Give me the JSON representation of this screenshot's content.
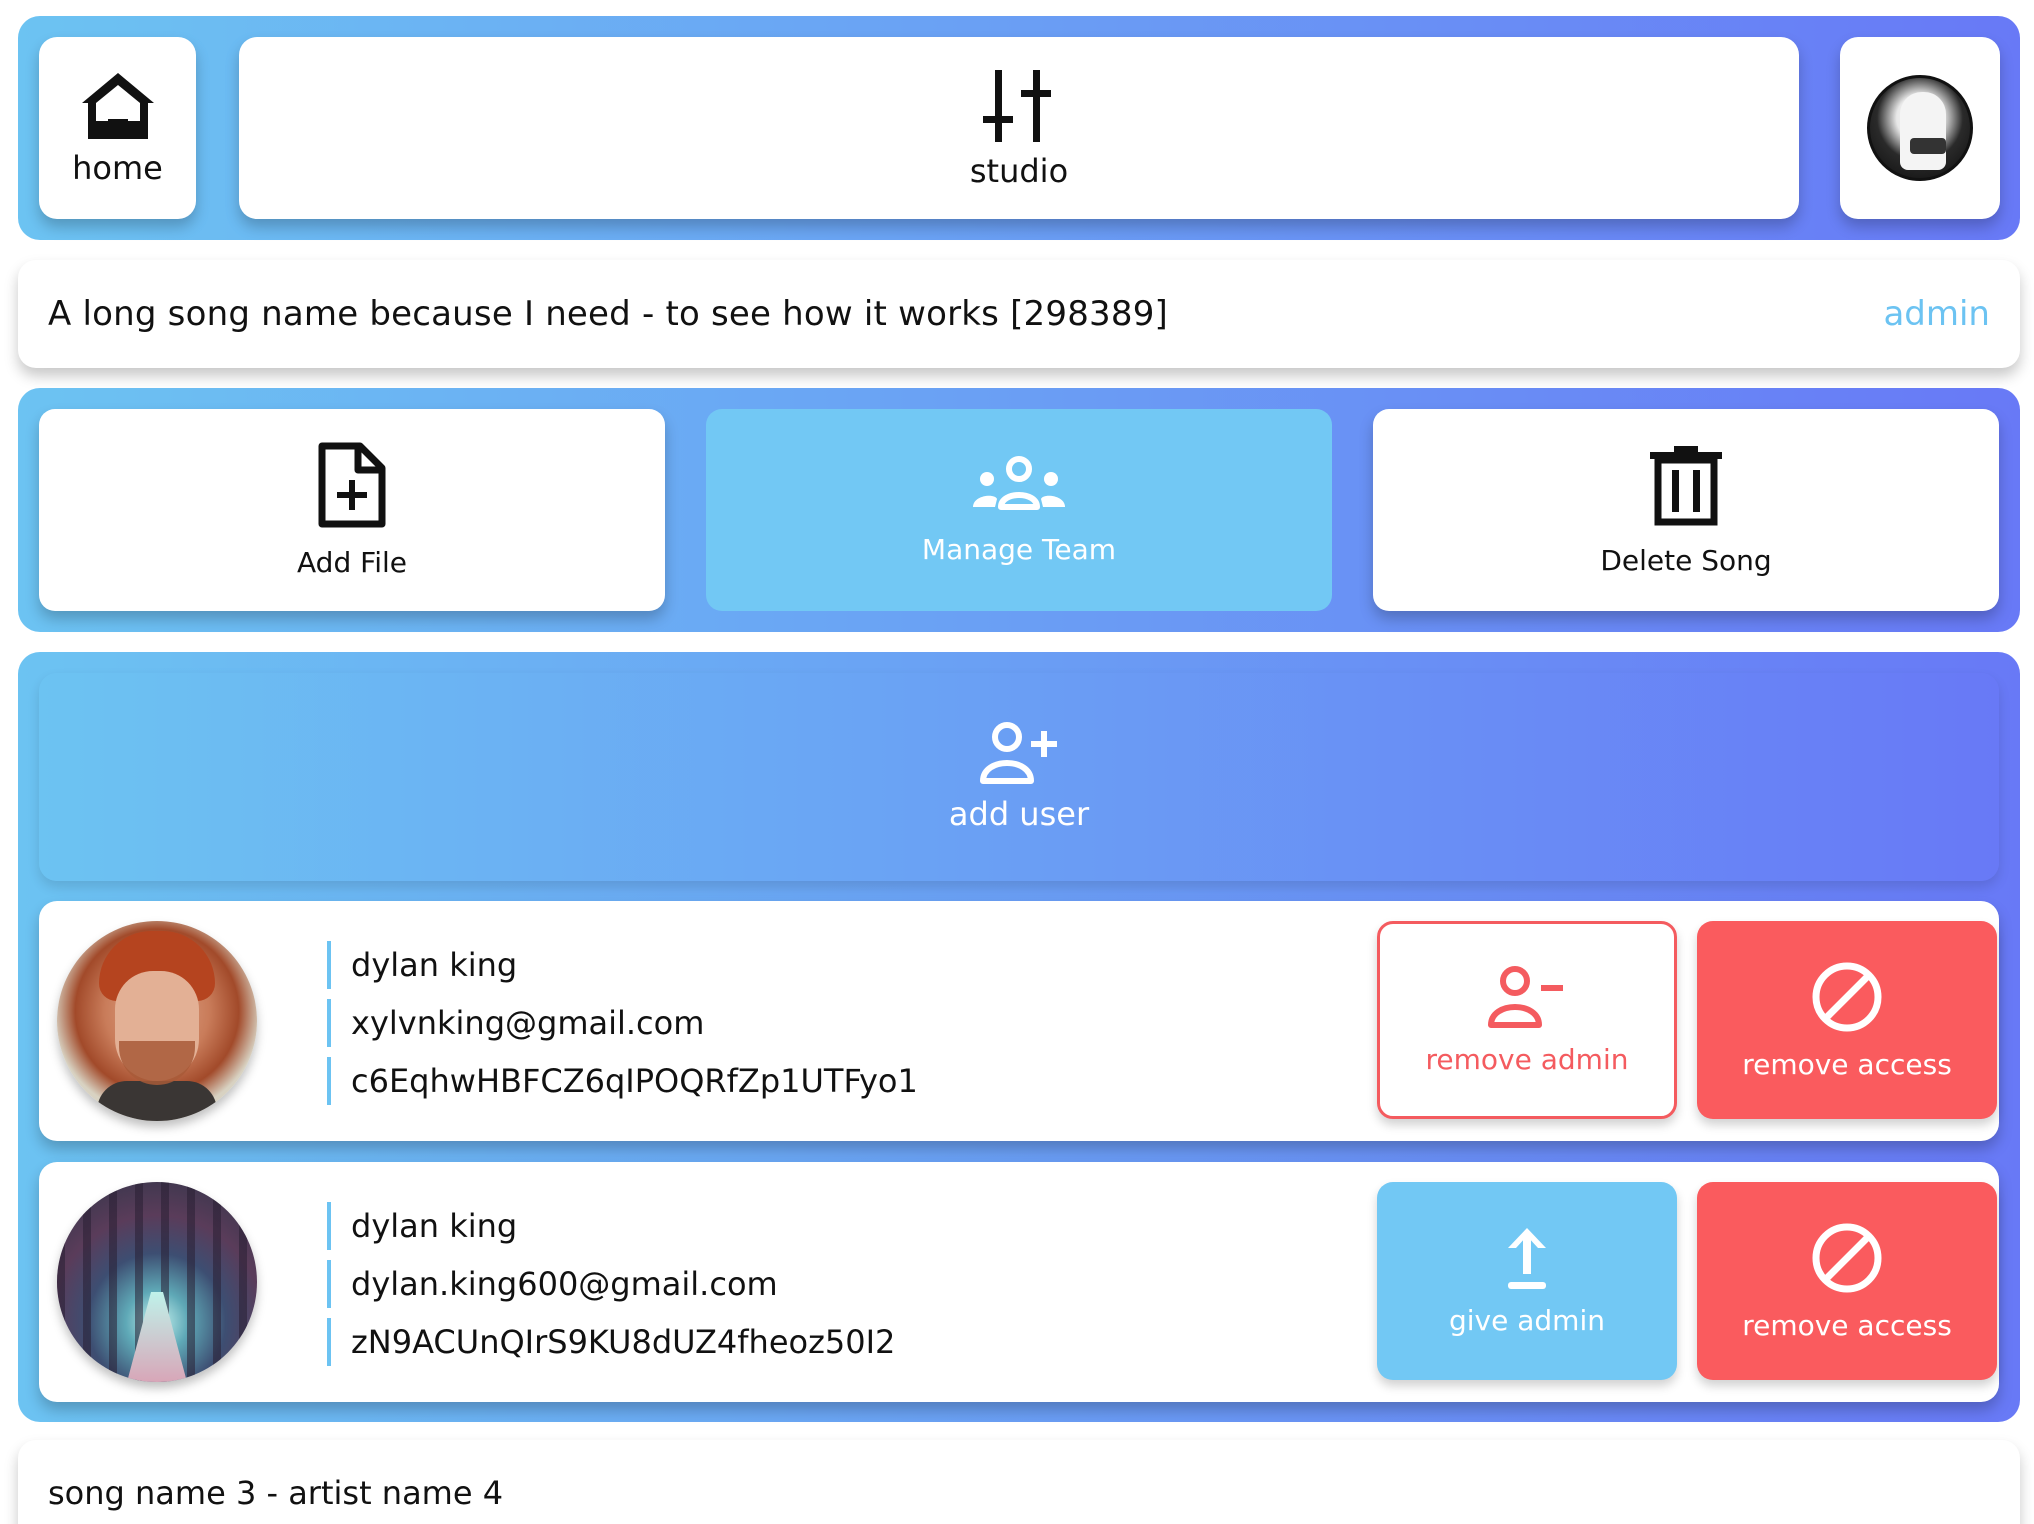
{
  "nav": {
    "home_label": "home",
    "studio_label": "studio",
    "profile_icon": "profile-avatar"
  },
  "song": {
    "title": "A long song name because I need - to see how it works [298389]",
    "role": "admin"
  },
  "actions": [
    {
      "label": "Add File",
      "icon": "file-plus-icon"
    },
    {
      "label": "Manage Team",
      "icon": "team-icon"
    },
    {
      "label": "Delete Song",
      "icon": "trash-icon"
    }
  ],
  "team": {
    "add_user_label": "add user",
    "users": [
      {
        "name": "dylan king",
        "email": "xylvnking@gmail.com",
        "uid": "c6EqhwHBFCZ6qIPOQRfZp1UTFyo1",
        "primary_action": "remove admin",
        "secondary_action": "remove access"
      },
      {
        "name": "dylan king",
        "email": "dylan.king600@gmail.com",
        "uid": "zN9ACUnQIrS9KU8dUZ4fheoz50I2",
        "primary_action": "give admin",
        "secondary_action": "remove access"
      }
    ]
  },
  "next_song": {
    "title": "song name 3 - artist name 4"
  },
  "colors": {
    "gradient_start": "#6cc3f2",
    "gradient_end": "#6879f6",
    "accent_blue": "#72c8f4",
    "danger_red": "#fa5b5e"
  }
}
